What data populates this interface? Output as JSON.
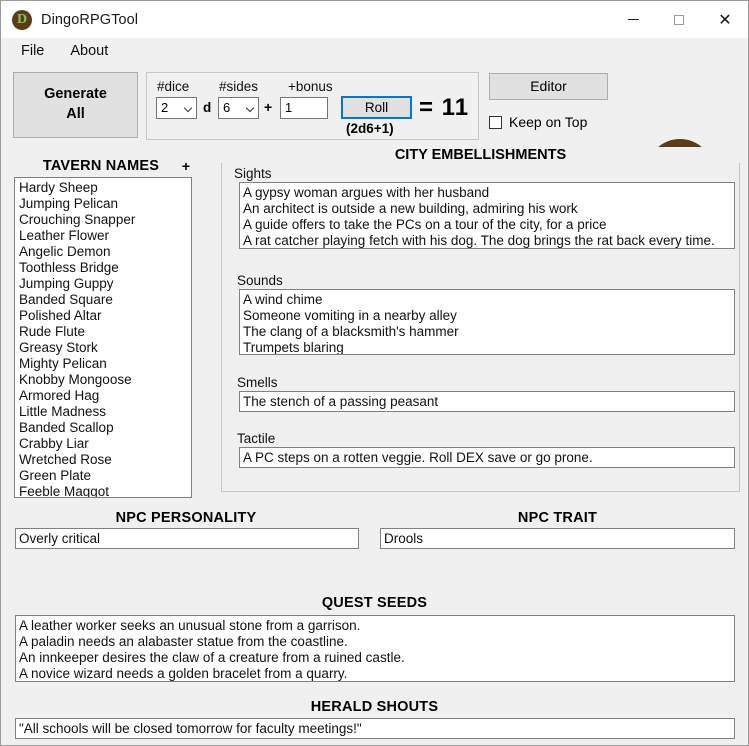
{
  "window": {
    "title": "DingoRPGTool",
    "icon": "app-logo-icon",
    "logo_letter": "D",
    "logo_bg": "#5a3d18",
    "logo_fg": "#86c05a",
    "minimize_label": "",
    "maximize_label": "",
    "close_label": "✕"
  },
  "menu": {
    "items": [
      {
        "label": "File"
      },
      {
        "label": "About"
      }
    ]
  },
  "toolbar": {
    "generate_all_label": "Generate\nAll",
    "generate_all_line1": "Generate",
    "generate_all_line2": "All",
    "editor_label": "Editor",
    "keep_on_top_label": "Keep on Top",
    "keep_on_top_checked": false,
    "dice": {
      "num_dice_label": "#dice",
      "num_sides_label": "#sides",
      "bonus_label": "+bonus",
      "num_dice_value": "2",
      "num_sides_value": "6",
      "bonus_value": "1",
      "d_separator": "d",
      "plus_separator": "+",
      "roll_label": "Roll",
      "formula": "(2d6+1)",
      "result": "= 11",
      "roll_focus_color": "#0078d7"
    }
  },
  "tavern_names": {
    "header": "TAVERN NAMES",
    "add_label": "+",
    "items": [
      "Hardy Sheep",
      "Jumping Pelican",
      "Crouching Snapper",
      "Leather Flower",
      "Angelic Demon",
      "Toothless Bridge",
      "Jumping Guppy",
      "Banded Square",
      "Polished Altar",
      "Rude Flute",
      "Greasy Stork",
      "Mighty Pelican",
      "Knobby Mongoose",
      "Armored Hag",
      "Little Madness",
      "Banded Scallop",
      "Crabby Liar",
      "Wretched Rose",
      "Green Plate",
      "Feeble Maggot"
    ]
  },
  "city_embellishments": {
    "title": "CITY EMBELLISHMENTS",
    "sights": {
      "label": "Sights",
      "lines": [
        "A gypsy woman argues with her husband",
        "An architect is outside a new building, admiring his work",
        "A guide offers to take the PCs on a tour of the city, for a price",
        "A rat catcher playing fetch with his dog. The dog brings the rat back every time."
      ]
    },
    "sounds": {
      "label": "Sounds",
      "lines": [
        "A wind chime",
        "Someone vomiting in a nearby alley",
        "The clang of a blacksmith's hammer",
        "Trumpets blaring"
      ]
    },
    "smells": {
      "label": "Smells",
      "lines": [
        "The stench of a passing peasant"
      ]
    },
    "tactile": {
      "label": "Tactile",
      "lines": [
        "A PC steps on a rotten veggie. Roll DEX save or go prone."
      ]
    }
  },
  "npc_personality": {
    "header": "NPC PERSONALITY",
    "value": "Overly critical"
  },
  "npc_trait": {
    "header": "NPC TRAIT",
    "value": "Drools"
  },
  "quest_seeds": {
    "header": "QUEST SEEDS",
    "lines": [
      "A leather worker seeks an unusual stone from a garrison.",
      "A paladin needs an alabaster statue from the coastline.",
      "An innkeeper desires the claw of a creature from a ruined castle.",
      "A novice wizard needs a golden bracelet from a quarry."
    ]
  },
  "herald_shouts": {
    "header": "HERALD SHOUTS",
    "lines": [
      "\"All schools will be closed tomorrow for faculty meetings!\""
    ]
  }
}
